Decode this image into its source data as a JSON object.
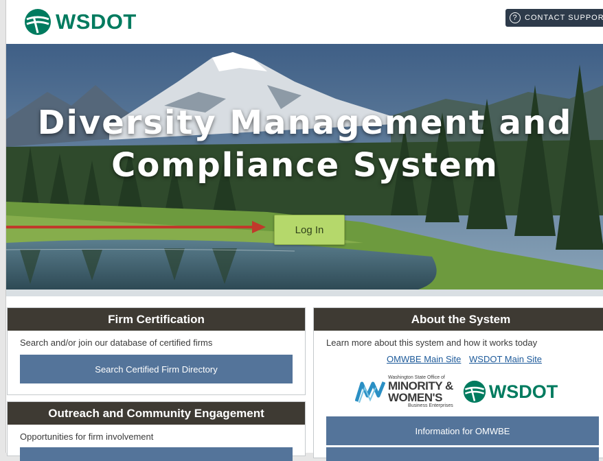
{
  "header": {
    "logo_text": "WSDOT",
    "contact_label": "CONTACT SUPPOR",
    "contact_icon": "question-circle-icon"
  },
  "hero": {
    "title_line1": "Diversity Management and",
    "title_line2": "Compliance System",
    "login_label": "Log In"
  },
  "panels": {
    "firm_certification": {
      "title": "Firm Certification",
      "description": "Search and/or join our database of certified firms",
      "button": "Search Certified Firm Directory"
    },
    "outreach": {
      "title": "Outreach and Community Engagement",
      "description": "Opportunities for firm involvement"
    },
    "about": {
      "title": "About the System",
      "description": "Learn more about this system and how it works today",
      "link1": "OMWBE Main Site",
      "link2": "WSDOT Main Site",
      "omwbe_logo": {
        "line1": "Washington State Office of",
        "line2": "MINORITY &",
        "line3": "WOMEN'S",
        "line4": "Business Enterprises"
      },
      "wsdot_logo_text": "WSDOT",
      "button": "Information for OMWBE"
    }
  },
  "colors": {
    "brand_green": "#007b5f",
    "panel_header": "#3e3a33",
    "button_blue": "#54749a",
    "login_green": "#b5d86b",
    "annotation_red": "#c0392b"
  }
}
